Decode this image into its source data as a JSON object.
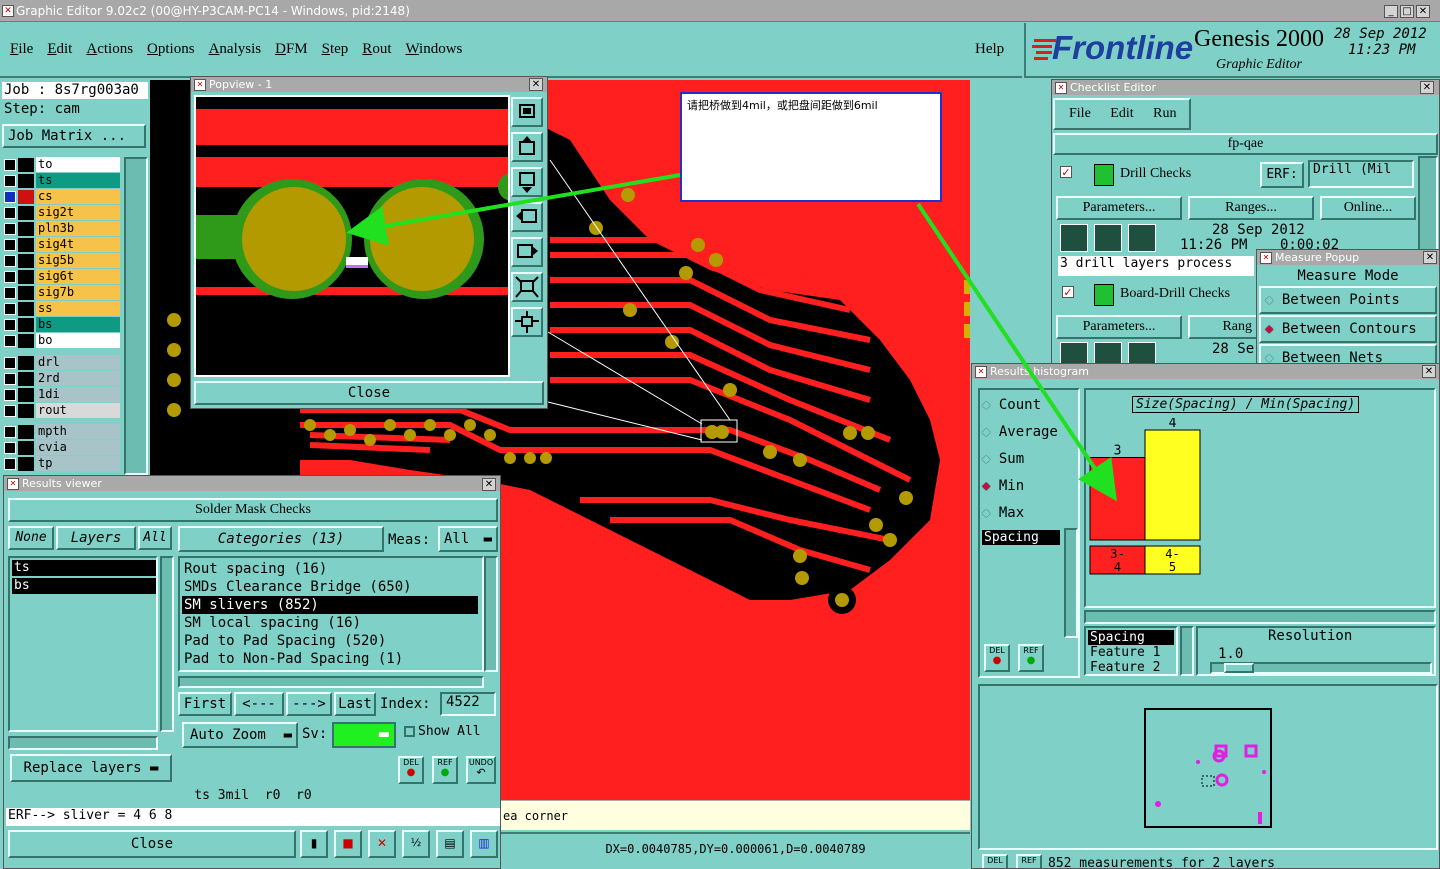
{
  "window": {
    "title": "Graphic Editor 9.02c2 (00@HY-P3CAM-PC14 - Windows, pid:2148)"
  },
  "menu": {
    "items": [
      "File",
      "Edit",
      "Actions",
      "Options",
      "Analysis",
      "DFM",
      "Step",
      "Rout",
      "Windows"
    ],
    "help": "Help"
  },
  "brand": {
    "logo": "Frontline",
    "product": "Genesis 2000",
    "subtitle": "Graphic Editor",
    "date": "28 Sep 2012",
    "time": "11:23 PM"
  },
  "job": {
    "job": "Job : 8s7rg003a0",
    "step": "Step: cam",
    "matrix_button": "Job Matrix ..."
  },
  "layers": [
    {
      "name": "to",
      "color": "#ffffff"
    },
    {
      "name": "ts",
      "color": "#0f9a84"
    },
    {
      "name": "cs",
      "color": "#f6c24a"
    },
    {
      "name": "sig2t",
      "color": "#f6c24a"
    },
    {
      "name": "pln3b",
      "color": "#f6c24a"
    },
    {
      "name": "sig4t",
      "color": "#f6c24a"
    },
    {
      "name": "sig5b",
      "color": "#f6c24a"
    },
    {
      "name": "sig6t",
      "color": "#f6c24a"
    },
    {
      "name": "sig7b",
      "color": "#f6c24a"
    },
    {
      "name": "ss",
      "color": "#f6c24a"
    },
    {
      "name": "bs",
      "color": "#0f9a84"
    },
    {
      "name": "bo",
      "color": "#ffffff"
    }
  ],
  "layers2": [
    {
      "name": "drl",
      "color": "#a9c4c8"
    },
    {
      "name": "2rd",
      "color": "#a9c4c8"
    },
    {
      "name": "1di",
      "color": "#a9c4c8"
    },
    {
      "name": "rout",
      "color": "#d9d9d9"
    }
  ],
  "layers3": [
    {
      "name": "mpth",
      "color": "#a9c4c8"
    },
    {
      "name": "cvia",
      "color": "#a9c4c8"
    },
    {
      "name": "tp",
      "color": "#a9c4c8"
    }
  ],
  "popview": {
    "title": "Popview - 1",
    "close": "Close"
  },
  "annotation": {
    "text": "请把桥做到4mil，或把盘间距做到6mil"
  },
  "results_viewer": {
    "title": "Results viewer",
    "header": "Solder Mask Checks",
    "none": "None",
    "layers": "Layers",
    "all": "All",
    "layer_list": [
      "ts",
      "bs"
    ],
    "categories": "Categories (13)",
    "meas_label": "Meas:",
    "meas_value": "All",
    "category_items": [
      "Rout spacing (16)",
      "SMDs Clearance Bridge (650)",
      "SM slivers (852)",
      "SM local spacing (16)",
      "Pad to Pad Spacing (520)",
      "Pad to Non-Pad Spacing (1)"
    ],
    "first": "First",
    "prev": "<---",
    "next": "--->",
    "last": "Last",
    "index_label": "Index:",
    "index_value": "4522",
    "auto_zoom": "Auto Zoom",
    "sv": "Sv:",
    "show_all": "Show All",
    "replace_layers": "Replace layers",
    "del": "DEL",
    "ref": "REF",
    "undo": "UNDO",
    "status": "ts 3mil  r0  r0",
    "erf": "ERF--> sliver = 4 6 8",
    "close": "Close"
  },
  "status_bar": {
    "hint": "ea corner",
    "coords": "DX=0.0040785,DY=0.000061,D=0.0040789"
  },
  "checklist": {
    "title": "Checklist Editor",
    "menu": [
      "File",
      "Edit",
      "Run"
    ],
    "name": "fp-qae",
    "drill_checks": "Drill Checks",
    "erf": "ERF:",
    "erf_value": "Drill (Mil",
    "parameters": "Parameters...",
    "ranges": "Ranges...",
    "online": "Online...",
    "date1": "28 Sep 2012",
    "time1": "11:26 PM",
    "time1b": "0:00:02",
    "summary": "3 drill layers process",
    "board_drill": "Board-Drill Checks",
    "parameters2": "Parameters...",
    "ranges2": "Rang",
    "date2": "28 Se"
  },
  "measure": {
    "title": "Measure Popup",
    "mode": "Measure Mode",
    "options": [
      "Between Points",
      "Between Contours",
      "Between Nets"
    ],
    "selected": 1
  },
  "histogram": {
    "title": "Results histogram",
    "stats": [
      "Count",
      "Average",
      "Sum",
      "Min",
      "Max"
    ],
    "selected_stat": 3,
    "list_selected": "Spacing",
    "axis_title": "Size(Spacing) / Min(Spacing)",
    "resolution_label": "Resolution",
    "resolution_value": "1.0",
    "list2": [
      "Spacing",
      "Feature 1",
      "Feature 2"
    ],
    "footer": "852 measurements for 2 layers",
    "del": "DEL",
    "ref": "REF"
  },
  "chart_data": {
    "type": "bar",
    "title": "Size(Spacing) / Min(Spacing)",
    "categories": [
      "3-4",
      "4-5"
    ],
    "values": [
      3,
      4
    ],
    "colors": [
      "#ff2020",
      "#ffff20"
    ]
  }
}
